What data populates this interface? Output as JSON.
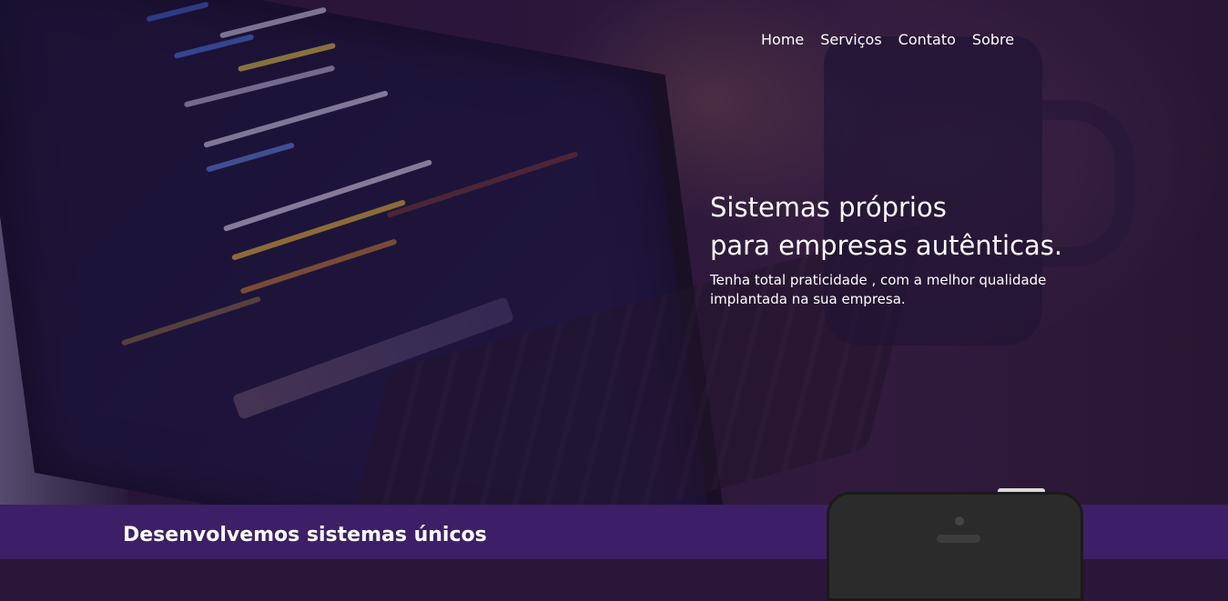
{
  "nav": {
    "items": [
      {
        "label": "Home"
      },
      {
        "label": "Serviços"
      },
      {
        "label": "Contato"
      },
      {
        "label": "Sobre"
      }
    ]
  },
  "hero": {
    "headline_line1": "Sistemas próprios",
    "headline_line2": "para empresas autênticas.",
    "subtext_line1": "Tenha total praticidade , com a melhor qualidade",
    "subtext_line2": "implantada na sua empresa."
  },
  "section": {
    "title": "Desenvolvemos sistemas únicos"
  },
  "colors": {
    "band_background": "#3c1f66",
    "hero_tint": "#2a1638",
    "text": "#ffffff"
  }
}
